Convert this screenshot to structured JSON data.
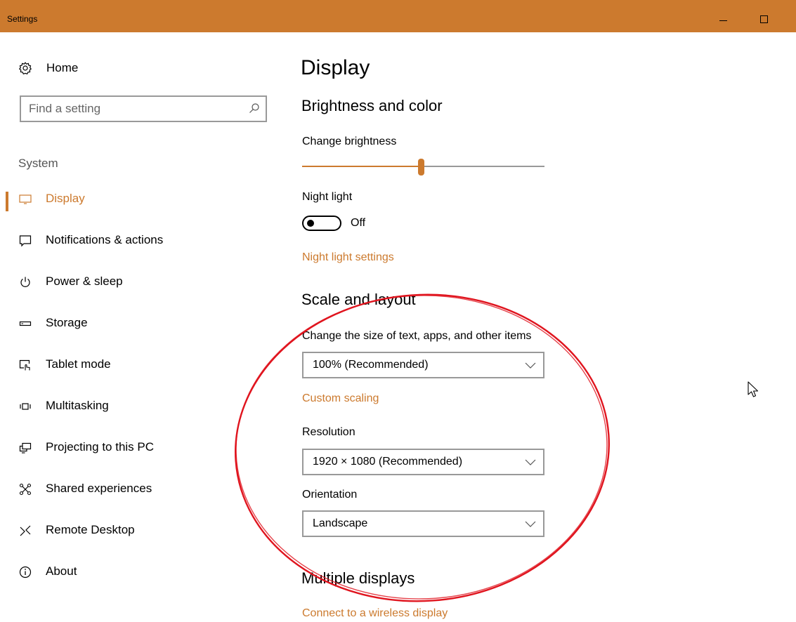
{
  "window": {
    "title": "Settings",
    "controls": [
      "minimize",
      "maximize"
    ]
  },
  "sidebar": {
    "home_label": "Home",
    "search_placeholder": "Find a setting",
    "section_label": "System",
    "items": [
      {
        "label": "Display",
        "icon": "monitor-icon",
        "active": true
      },
      {
        "label": "Notifications & actions",
        "icon": "message-icon"
      },
      {
        "label": "Power & sleep",
        "icon": "power-icon"
      },
      {
        "label": "Storage",
        "icon": "storage-icon"
      },
      {
        "label": "Tablet mode",
        "icon": "tablet-mode-icon"
      },
      {
        "label": "Multitasking",
        "icon": "multitasking-icon"
      },
      {
        "label": "Projecting to this PC",
        "icon": "projecting-icon"
      },
      {
        "label": "Shared experiences",
        "icon": "shared-experiences-icon"
      },
      {
        "label": "Remote Desktop",
        "icon": "remote-desktop-icon"
      },
      {
        "label": "About",
        "icon": "info-icon"
      }
    ]
  },
  "main": {
    "title": "Display",
    "brightness_section": {
      "heading": "Brightness and color",
      "brightness_label": "Change brightness",
      "brightness_value": 0.49,
      "night_light_label": "Night light",
      "night_light_state": "Off",
      "night_light_link": "Night light settings"
    },
    "scale_section": {
      "heading": "Scale and layout",
      "size_label": "Change the size of text, apps, and other items",
      "size_value": "100% (Recommended)",
      "custom_scaling_link": "Custom scaling",
      "resolution_label": "Resolution",
      "resolution_value": "1920 × 1080 (Recommended)",
      "orientation_label": "Orientation",
      "orientation_value": "Landscape"
    },
    "multiple_displays_section": {
      "heading": "Multiple displays",
      "wireless_link": "Connect to a wireless display"
    }
  },
  "colors": {
    "accent": "#cc7a2e",
    "annotation": "#e0141e"
  }
}
